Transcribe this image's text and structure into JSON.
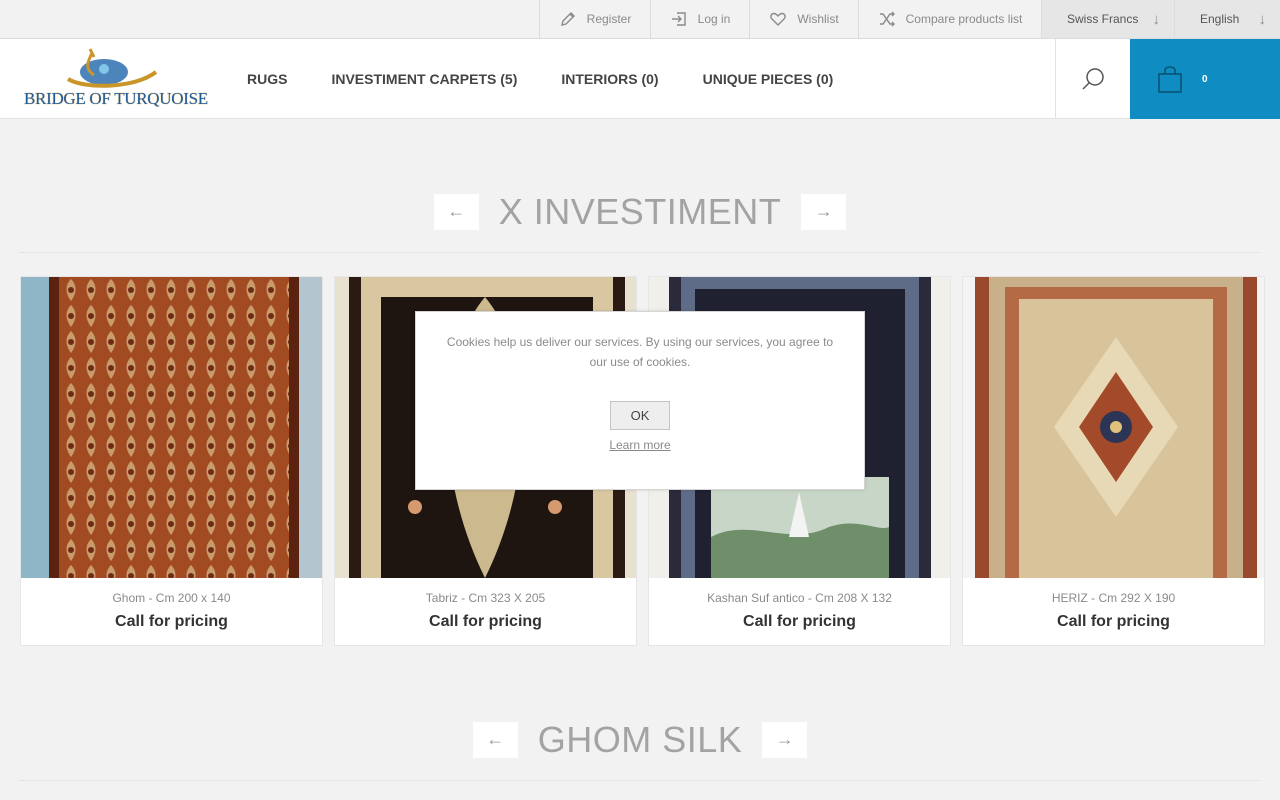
{
  "topbar": {
    "register": "Register",
    "login": "Log in",
    "wishlist": "Wishlist",
    "compare": "Compare products list",
    "currency": "Swiss Francs",
    "language": "English"
  },
  "header": {
    "logo_text": "BRIDGE OF TURQUOISE",
    "nav": [
      "RUGS",
      "INVESTIMENT CARPETS (5)",
      "INTERIORS (0)",
      "UNIQUE PIECES (0)"
    ],
    "cart_count": "0"
  },
  "sections": {
    "first_title": "X INVESTIMENT",
    "second_title": "GHOM SILK"
  },
  "products": [
    {
      "name": "Ghom - Cm 200 x 140",
      "price": "Call for pricing"
    },
    {
      "name": "Tabriz - Cm 323 X 205",
      "price": "Call for pricing"
    },
    {
      "name": "Kashan Suf antico - Cm 208 X 132",
      "price": "Call for pricing"
    },
    {
      "name": "HERIZ - Cm 292 X 190",
      "price": "Call for pricing"
    }
  ],
  "cookie": {
    "message": "Cookies help us deliver our services. By using our services, you agree to our use of cookies.",
    "ok": "OK",
    "learn_more": "Learn more"
  },
  "colors": {
    "accent": "#0f8dc3",
    "background": "#f2f2f2"
  }
}
